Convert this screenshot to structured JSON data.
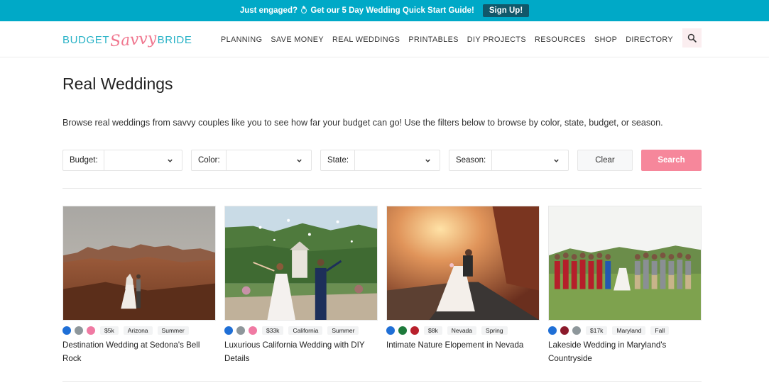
{
  "promo": {
    "text_before": "Just engaged?",
    "text_after": "Get our 5 Day Wedding Quick Start Guide!",
    "button": "Sign Up!"
  },
  "logo": {
    "part1": "BUDGET",
    "part2": "Savvy",
    "part3": "BRIDE"
  },
  "nav": [
    "PLANNING",
    "SAVE MONEY",
    "REAL WEDDINGS",
    "PRINTABLES",
    "DIY PROJECTS",
    "RESOURCES",
    "SHOP",
    "DIRECTORY"
  ],
  "page": {
    "title": "Real Weddings",
    "intro": "Browse real weddings from savvy couples like you to see how far your budget can go! Use the filters below to browse by color, state, budget, or season."
  },
  "filters": {
    "budget": "Budget:",
    "color": "Color:",
    "state": "State:",
    "season": "Season:",
    "clear": "Clear",
    "search": "Search"
  },
  "cards": [
    {
      "colors": [
        "#1f6fd6",
        "#8e979b",
        "#f07aa3"
      ],
      "budget": "$5k",
      "state": "Arizona",
      "season": "Summer",
      "title": "Destination Wedding at Sedona's Bell Rock"
    },
    {
      "colors": [
        "#1f6fd6",
        "#8e979b",
        "#f07aa3"
      ],
      "budget": "$33k",
      "state": "California",
      "season": "Summer",
      "title": "Luxurious California Wedding with DIY Details"
    },
    {
      "colors": [
        "#1f6fd6",
        "#1d7a3b",
        "#b8202c"
      ],
      "budget": "$8k",
      "state": "Nevada",
      "season": "Spring",
      "title": "Intimate Nature Elopement in Nevada"
    },
    {
      "colors": [
        "#1f6fd6",
        "#8b1a2b",
        "#8e979b"
      ],
      "budget": "$17k",
      "state": "Maryland",
      "season": "Fall",
      "title": "Lakeside Wedding in Maryland's Countryside"
    }
  ]
}
